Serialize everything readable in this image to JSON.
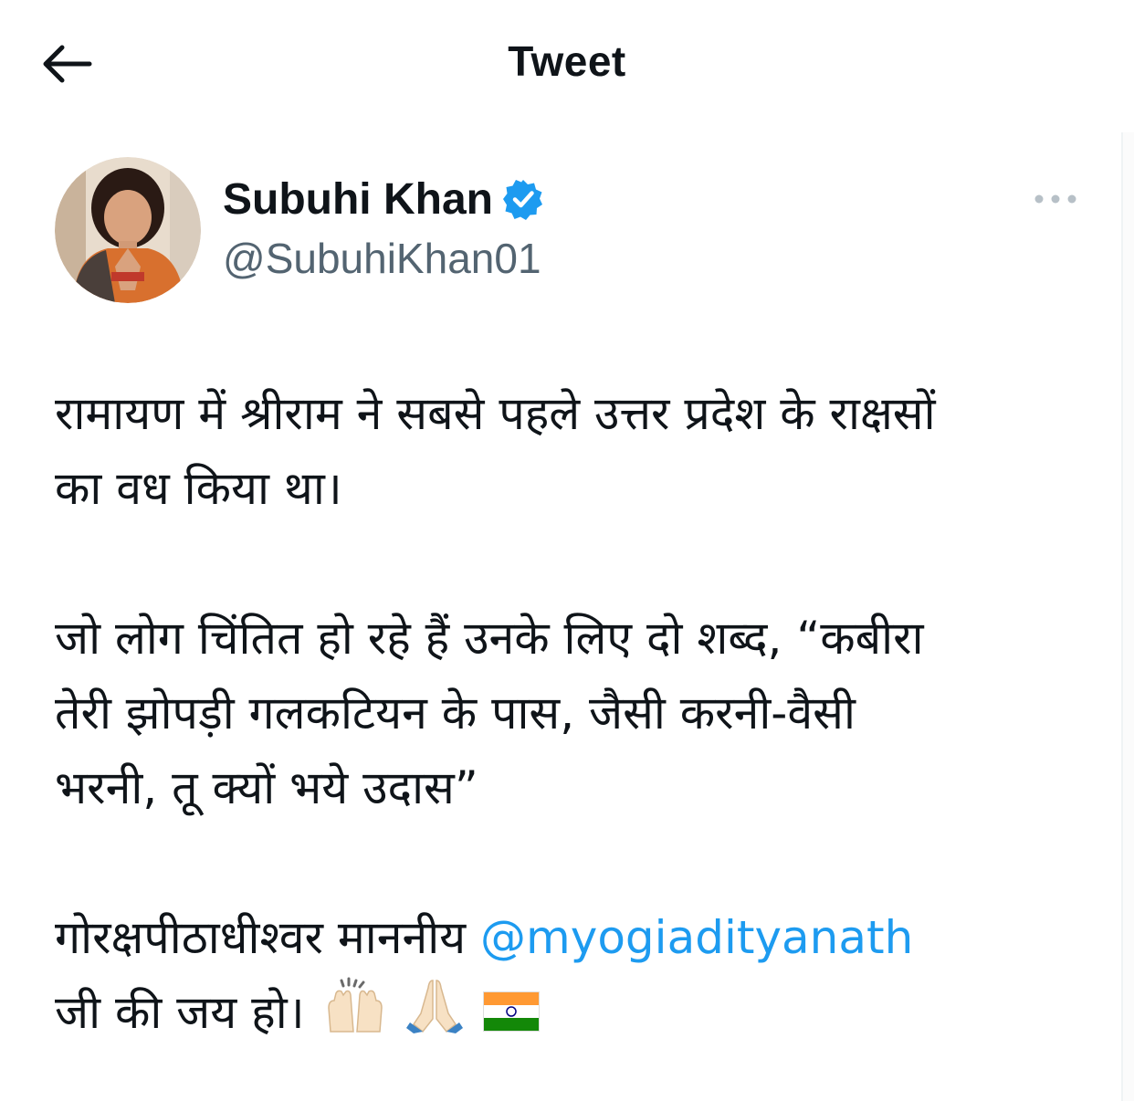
{
  "header": {
    "title": "Tweet",
    "back_icon": "arrow-left-icon"
  },
  "author": {
    "display_name": "Subuhi Khan",
    "handle": "@SubuhiKhan01",
    "verified_icon": "verified-badge-icon",
    "verified_color": "#1d9bf0",
    "avatar_icon": "avatar-photo"
  },
  "more_icon": "more-horizontal-icon",
  "tweet": {
    "line_1": "रामायण में श्रीराम ने सबसे पहले उत्तर प्रदेश के राक्षसों",
    "line_2": "का वध किया था।",
    "line_3": "जो लोग चिंतित हो रहे हैं उनके लिए दो शब्द, “कबीरा",
    "line_4": "तेरी झोपड़ी गलकटियन के पास, जैसी करनी-वैसी",
    "line_5": "भरनी, तू क्यों भये उदास”",
    "line_6_prefix": "गोरक्षपीठाधीश्वर माननीय ",
    "mention": "@myogiadityanath",
    "line_7": "जी की जय हो।",
    "emojis": [
      "raising-hands-emoji",
      "folded-hands-emoji",
      "india-flag-emoji"
    ]
  },
  "colors": {
    "text": "#0f1419",
    "secondary": "#536471",
    "accent": "#1d9bf0"
  }
}
